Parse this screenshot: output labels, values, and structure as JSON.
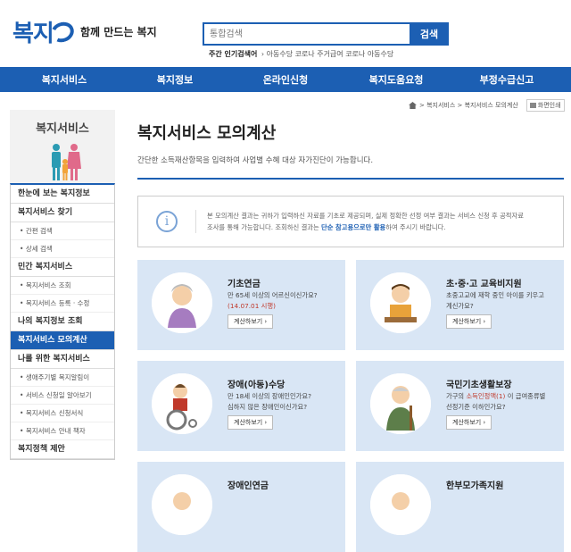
{
  "header": {
    "logo": "복지",
    "slogan": "함께 만드는 복지",
    "search_placeholder": "통합검색",
    "search_button": "검색",
    "popular_label": "주간 인기검색어",
    "popular_items": "아동수당  코로나  주거급여  코로나 아동수당"
  },
  "nav": [
    "복지서비스",
    "복지정보",
    "온라인신청",
    "복지도움요청",
    "부정수급신고"
  ],
  "breadcrumb": {
    "path": "> 복지서비스 > 복지서비스 모의계산",
    "print": "화면인쇄"
  },
  "sidebar": {
    "title": "복지서비스",
    "items": [
      {
        "label": "한눈에 보는 복지정보",
        "type": "main"
      },
      {
        "label": "복지서비스 찾기",
        "type": "main"
      },
      {
        "label": "간편 검색",
        "type": "sub"
      },
      {
        "label": "상세 검색",
        "type": "sub"
      },
      {
        "label": "민간 복지서비스",
        "type": "main"
      },
      {
        "label": "복지서비스 조회",
        "type": "sub"
      },
      {
        "label": "복지서비스 등록 · 수정",
        "type": "sub"
      },
      {
        "label": "나의 복지정보 조회",
        "type": "main"
      },
      {
        "label": "복지서비스 모의계산",
        "type": "active"
      },
      {
        "label": "나를 위한 복지서비스",
        "type": "main"
      },
      {
        "label": "생애주기별 복지알림이",
        "type": "sub"
      },
      {
        "label": "서비스 신청일 알아보기",
        "type": "sub"
      },
      {
        "label": "복지서비스 신청서식",
        "type": "sub"
      },
      {
        "label": "복지서비스 안내 책자",
        "type": "sub"
      },
      {
        "label": "복지정책 제안",
        "type": "main"
      }
    ]
  },
  "main": {
    "title": "복지서비스 모의계산",
    "description": "간단한 소득재산항목을 입력하여 사업별 수혜 대상 자가진단이 가능합니다.",
    "notice_line1": "본 모의계산 결과는 귀하가 입력하신 자료를 기초로 제공되며, 실제 정확한 선정 여부 결과는 서비스 신청 후 공적자료",
    "notice_line2a": "조사를 통해 가능합니다. 조회하신 결과는 ",
    "notice_line2b": "단순 참고용으로만 활용",
    "notice_line2c": "하여 주시기 바랍니다.",
    "cards": [
      {
        "title": "기초연금",
        "desc1": "만 65세 이상의 어르신이신가요?",
        "desc2": "(14.07.01 시행)",
        "button": "계산하보기"
      },
      {
        "title": "초·중·고 교육비지원",
        "desc1": "초중고교에 재학 중인 아이를 키우고",
        "desc2": "계신가요?",
        "button": "계산하보기"
      },
      {
        "title": "장애(아동)수당",
        "desc1": "만 18세 이상의 장애인인가요?",
        "desc2": "심하지 않은 장애인이신가요?",
        "button": "계산하보기"
      },
      {
        "title": "국민기초생활보장",
        "desc1a": "가구의 ",
        "desc1b": "소득인정액(1)",
        "desc1c": " 이 급여종류별",
        "desc2": "선정기준 이하인가요?",
        "button": "계산하보기"
      },
      {
        "title": "장애인연금"
      },
      {
        "title": "한부모가족지원"
      }
    ]
  }
}
